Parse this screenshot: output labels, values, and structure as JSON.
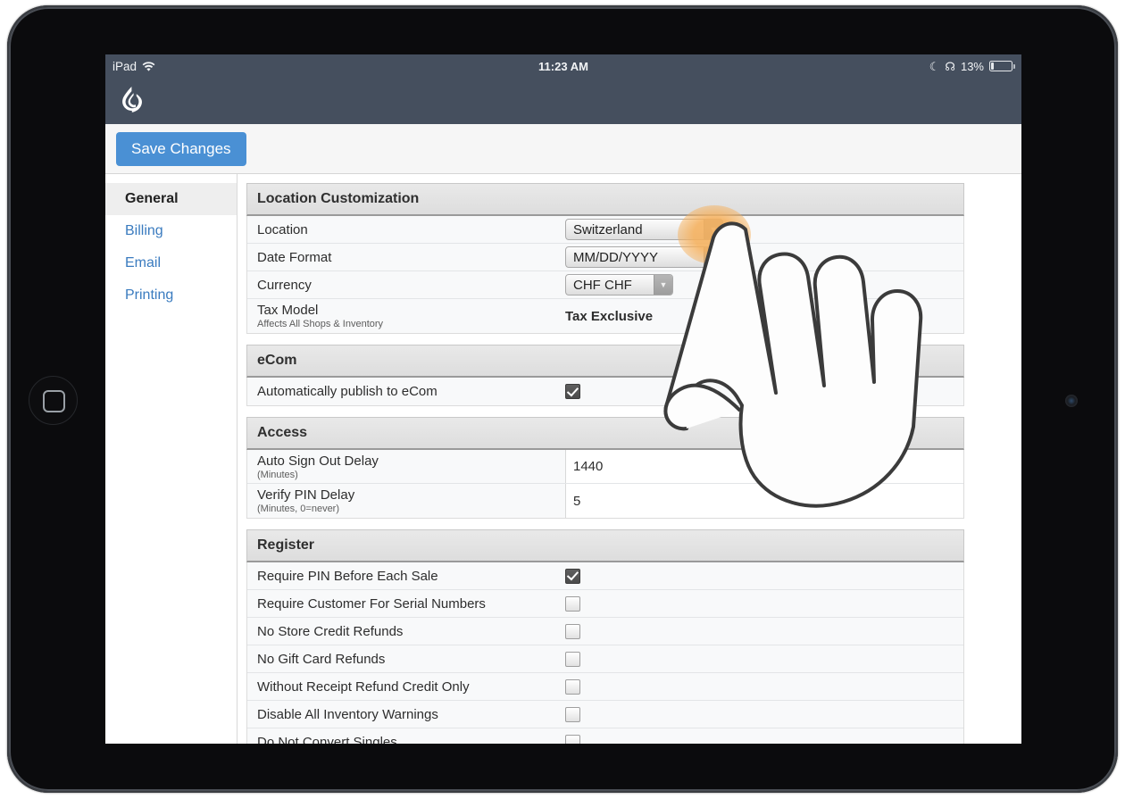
{
  "statusbar": {
    "device_label": "iPad",
    "wifi_icon": "wifi-icon",
    "time": "11:23 AM",
    "moon_icon": "moon-icon",
    "bluetooth_icon": "bluetooth-icon",
    "battery_percent": "13%",
    "battery_level": 13
  },
  "header": {
    "logo_icon": "lightspeed-logo-icon"
  },
  "toolbar": {
    "save_label": "Save Changes",
    "accent_color": "#4a90d4"
  },
  "sidebar": {
    "items": [
      {
        "label": "General",
        "active": true
      },
      {
        "label": "Billing",
        "active": false
      },
      {
        "label": "Email",
        "active": false
      },
      {
        "label": "Printing",
        "active": false
      }
    ]
  },
  "sections": {
    "location": {
      "title": "Location Customization",
      "rows": {
        "location": {
          "label": "Location",
          "value": "Switzerland"
        },
        "date_format": {
          "label": "Date Format",
          "value": "MM/DD/YYYY"
        },
        "currency": {
          "label": "Currency",
          "value": "CHF CHF"
        },
        "tax_model": {
          "label": "Tax Model",
          "sub": "Affects All Shops & Inventory",
          "value": "Tax Exclusive"
        }
      }
    },
    "ecom": {
      "title": "eCom",
      "rows": {
        "auto_publish": {
          "label": "Automatically publish to eCom",
          "checked": true
        }
      }
    },
    "access": {
      "title": "Access",
      "rows": {
        "auto_sign_out": {
          "label": "Auto Sign Out Delay",
          "sub": "(Minutes)",
          "value": "1440"
        },
        "verify_pin": {
          "label": "Verify PIN Delay",
          "sub": "(Minutes, 0=never)",
          "value": "5"
        }
      }
    },
    "register": {
      "title": "Register",
      "rows": [
        {
          "label": "Require PIN Before Each Sale",
          "checked": true
        },
        {
          "label": "Require Customer For Serial Numbers",
          "checked": false
        },
        {
          "label": "No Store Credit Refunds",
          "checked": false
        },
        {
          "label": "No Gift Card Refunds",
          "checked": false
        },
        {
          "label": "Without Receipt Refund Credit Only",
          "checked": false
        },
        {
          "label": "Disable All Inventory Warnings",
          "checked": false
        },
        {
          "label": "Do Not Convert Singles",
          "checked": false
        }
      ]
    }
  },
  "cursor": {
    "icon": "pointing-hand-cursor-icon",
    "tap_highlight_color": "#f5b05c"
  }
}
